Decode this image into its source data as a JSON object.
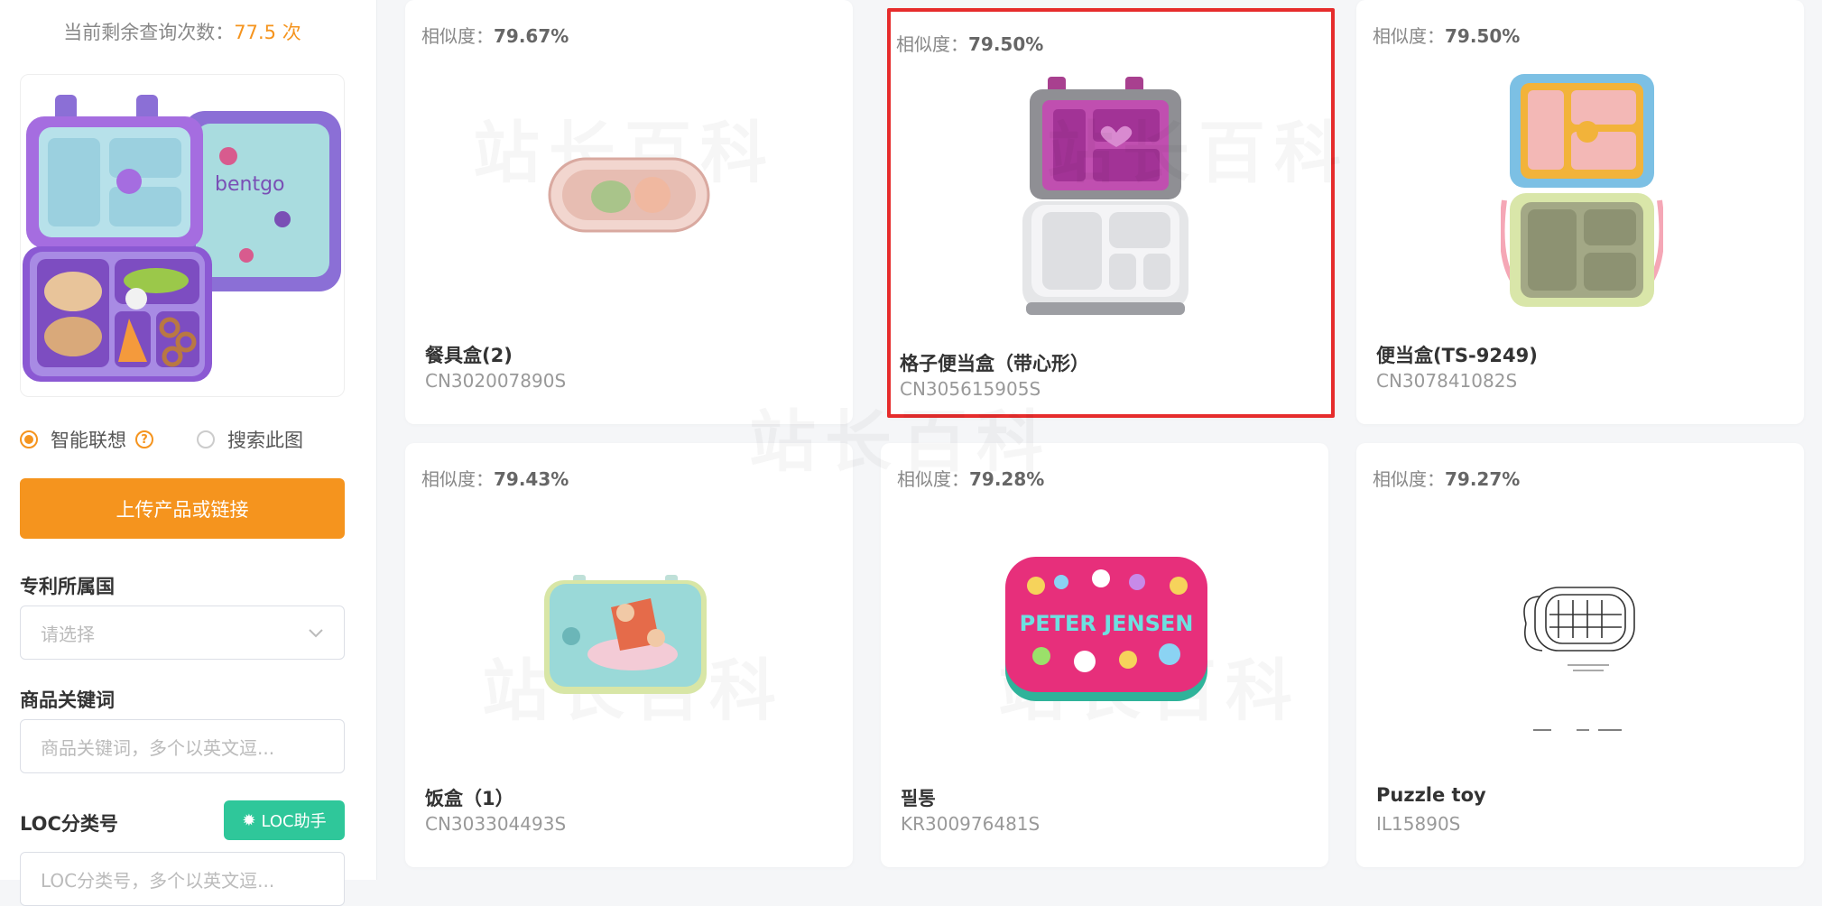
{
  "sidebar": {
    "quota_prefix": "当前剩余查询次数：",
    "quota_value": "77.5 次",
    "radio_smart": "智能联想",
    "radio_search": "搜索此图",
    "upload_label": "上传产品或链接",
    "patent_label": "专利所属国",
    "patent_placeholder": "请选择",
    "keyword_label": "商品关键词",
    "keyword_placeholder": "商品关键词，多个以英文逗...",
    "loc_label": "LOC分类号",
    "loc_button": "LOC助手",
    "loc_placeholder": "LOC分类号，多个以英文逗..."
  },
  "watermark": "站长百科",
  "results": [
    {
      "sim_label": "相似度：",
      "sim": "79.67%",
      "name": "餐具盒(2)",
      "code": "CN302007890S"
    },
    {
      "sim_label": "相似度：",
      "sim": "79.50%",
      "name": "格子便当盒（带心形）",
      "code": "CN305615905S",
      "selected": true
    },
    {
      "sim_label": "相似度：",
      "sim": "79.50%",
      "name": "便当盒(TS-9249)",
      "code": "CN307841082S"
    },
    {
      "sim_label": "相似度：",
      "sim": "79.43%",
      "name": "饭盒（1）",
      "code": "CN303304493S"
    },
    {
      "sim_label": "相似度：",
      "sim": "79.28%",
      "name": "필통",
      "code": "KR300976481S"
    },
    {
      "sim_label": "相似度：",
      "sim": "79.27%",
      "name": "Puzzle toy",
      "code": "IL15890S"
    }
  ],
  "images": {
    "preview_brand": "bentgo",
    "pencil_case_brand": "PETER JENSEN"
  },
  "colors": {
    "accent": "#f5941e",
    "loc": "#2fc79a",
    "highlight": "#e62c2c"
  }
}
